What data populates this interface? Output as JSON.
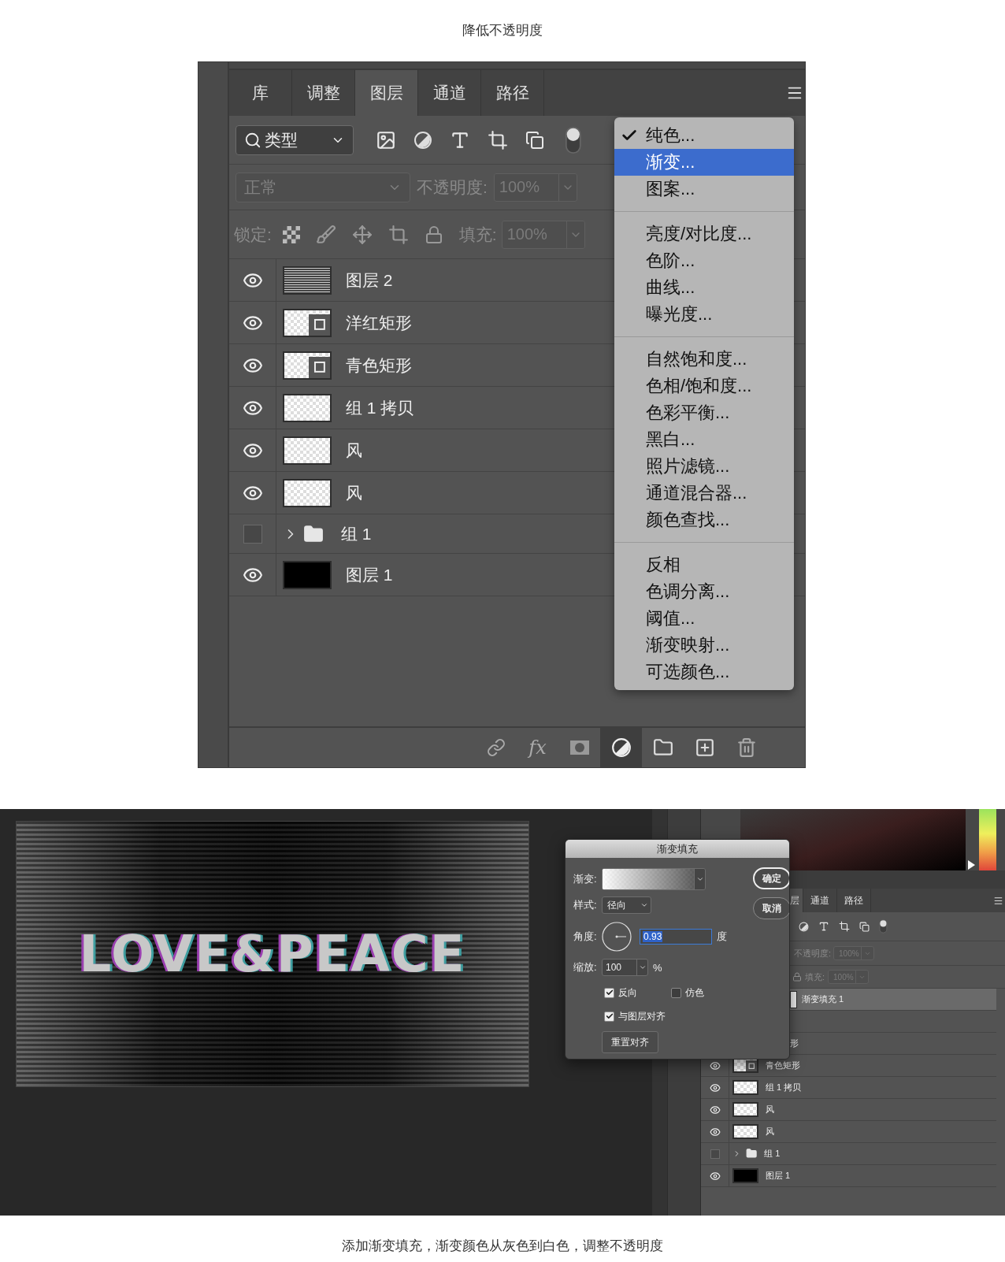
{
  "top_caption": "降低不透明度",
  "layers_panel": {
    "tabs": [
      {
        "label": "库",
        "selected": false
      },
      {
        "label": "调整",
        "selected": false
      },
      {
        "label": "图层",
        "selected": true
      },
      {
        "label": "通道",
        "selected": false
      },
      {
        "label": "路径",
        "selected": false
      }
    ],
    "filter": {
      "value": "类型",
      "on": true
    },
    "blend_mode": {
      "value": "正常",
      "disabled": true
    },
    "opacity": {
      "label": "不透明度:",
      "value": "100%",
      "disabled": true
    },
    "lock": {
      "label": "锁定:"
    },
    "fill": {
      "label": "填充:",
      "value": "100%",
      "disabled": true
    },
    "layers": [
      {
        "label": "图层 2",
        "visible": true,
        "kind": "lines"
      },
      {
        "label": "洋红矩形",
        "visible": true,
        "kind": "shape"
      },
      {
        "label": "青色矩形",
        "visible": true,
        "kind": "shape"
      },
      {
        "label": "组 1 拷贝",
        "visible": true,
        "kind": "pattern"
      },
      {
        "label": "风",
        "visible": true,
        "kind": "pattern"
      },
      {
        "label": "风",
        "visible": true,
        "kind": "pattern"
      },
      {
        "label": "组 1",
        "visible": false,
        "kind": "folder"
      },
      {
        "label": "图层 1",
        "visible": true,
        "kind": "black"
      }
    ],
    "footer": {
      "fx": "fx"
    },
    "menu": {
      "groups": [
        [
          {
            "label": "纯色...",
            "checked": true,
            "selected": false
          },
          {
            "label": "渐变...",
            "checked": false,
            "selected": true
          },
          {
            "label": "图案...",
            "checked": false,
            "selected": false
          }
        ],
        [
          {
            "label": "亮度/对比度...",
            "checked": false,
            "selected": false
          },
          {
            "label": "色阶...",
            "checked": false,
            "selected": false
          },
          {
            "label": "曲线...",
            "checked": false,
            "selected": false
          },
          {
            "label": "曝光度...",
            "checked": false,
            "selected": false
          }
        ],
        [
          {
            "label": "自然饱和度...",
            "checked": false,
            "selected": false
          },
          {
            "label": "色相/饱和度...",
            "checked": false,
            "selected": false
          },
          {
            "label": "色彩平衡...",
            "checked": false,
            "selected": false
          },
          {
            "label": "黑白...",
            "checked": false,
            "selected": false
          },
          {
            "label": "照片滤镜...",
            "checked": false,
            "selected": false
          },
          {
            "label": "通道混合器...",
            "checked": false,
            "selected": false
          },
          {
            "label": "颜色查找...",
            "checked": false,
            "selected": false
          }
        ],
        [
          {
            "label": "反相",
            "checked": false,
            "selected": false
          },
          {
            "label": "色调分离...",
            "checked": false,
            "selected": false
          },
          {
            "label": "阈值...",
            "checked": false,
            "selected": false
          },
          {
            "label": "渐变映射...",
            "checked": false,
            "selected": false
          },
          {
            "label": "可选颜色...",
            "checked": false,
            "selected": false
          }
        ]
      ]
    }
  },
  "editor": {
    "canvas": {
      "text": "LOVE&PEACE"
    },
    "hue_slider": {
      "level": 0.02
    },
    "dialog": {
      "title": "渐变填充",
      "gradient_label": "渐变:",
      "style_label": "样式:",
      "style": "径向",
      "angle_label": "角度:",
      "angle": "0.93",
      "angle_unit": "度",
      "scale_label": "缩放:",
      "scale": "100",
      "scale_unit": "%",
      "options": [
        {
          "label": "反向",
          "checked": true
        },
        {
          "label": "仿色",
          "checked": false
        },
        {
          "label": "与图层对齐",
          "checked": true
        }
      ],
      "reset": "重置对齐",
      "ok": "确定",
      "cancel": "取消"
    },
    "panel": {
      "tabs": [
        {
          "label": "层",
          "selected": true
        },
        {
          "label": "通道",
          "selected": false
        },
        {
          "label": "路径",
          "selected": false
        }
      ],
      "filter_on": true,
      "opacity": {
        "label": "不透明度:",
        "value": "100%",
        "disabled": true
      },
      "fill": {
        "label": "填充:",
        "value": "100%",
        "disabled": true
      },
      "layers": [
        {
          "kind": "covered",
          "label": "渐变填充 1",
          "selected": true
        },
        {
          "kind": "covered",
          "selected": false
        },
        {
          "kind": "covered",
          "label": "形",
          "selected": false
        },
        {
          "kind": "shape",
          "label": "青色矩形",
          "visible": true,
          "selected": false
        },
        {
          "kind": "pattern",
          "label": "组 1 拷贝",
          "visible": true,
          "selected": false
        },
        {
          "kind": "pattern",
          "label": "风",
          "visible": true,
          "selected": false
        },
        {
          "kind": "pattern",
          "label": "风",
          "visible": true,
          "selected": false
        },
        {
          "kind": "folder",
          "label": "组 1",
          "visible": false,
          "selected": false
        },
        {
          "kind": "black",
          "label": "图层 1",
          "visible": true,
          "selected": false
        }
      ]
    }
  },
  "bottom_caption": "添加渐变填充，渐变颜色从灰色到白色，调整不透明度"
}
